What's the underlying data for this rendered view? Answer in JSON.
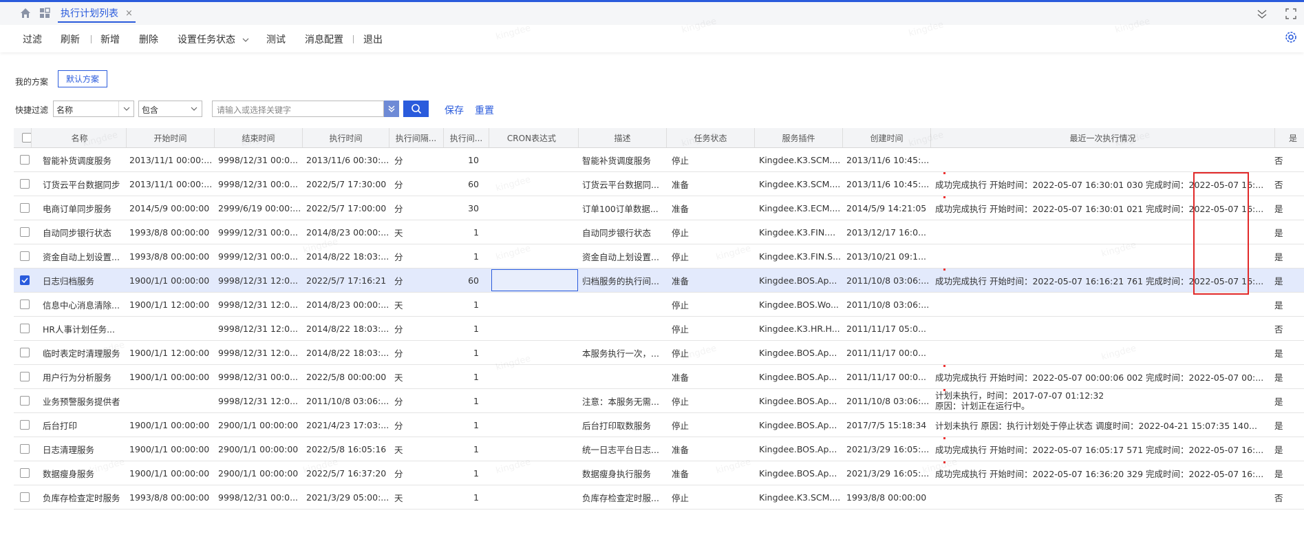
{
  "tabs": {
    "active_label": "执行计划列表",
    "close_glyph": "×"
  },
  "toolbar": {
    "filter": "过滤",
    "refresh": "刷新",
    "add": "新增",
    "delete": "删除",
    "set_status": "设置任务状态",
    "test": "测试",
    "msg_config": "消息配置",
    "exit": "退出"
  },
  "scheme": {
    "label": "我的方案",
    "default_btn": "默认方案"
  },
  "quick_filter": {
    "label": "快捷过滤",
    "field_value": "名称",
    "operator_value": "包含",
    "keyword_placeholder": "请输入或选择关键字",
    "save": "保存",
    "reset": "重置"
  },
  "table": {
    "headers": {
      "name": "名称",
      "start": "开始时间",
      "end": "结束时间",
      "exec_time": "执行时间",
      "interval_unit": "执行间隔...",
      "interval": "执行间...",
      "cron": "CRON表达式",
      "desc": "描述",
      "status": "任务状态",
      "plugin": "服务插件",
      "created": "创建时间",
      "last_exec": "最近一次执行情况",
      "enabled": "是"
    },
    "rows": [
      {
        "checked": false,
        "name": "智能补货调度服务",
        "start": "2013/11/1 00:00:...",
        "end": "9998/12/31 00:0...",
        "exec": "2013/11/6 00:30:...",
        "unit": "分",
        "interval": "10",
        "desc": "智能补货调度服务",
        "status": "停止",
        "plugin": "Kingdee.K3.SCM....",
        "created": "2013/11/6 10:45:...",
        "last1": "",
        "last2": "",
        "enabled": "否",
        "mark": false
      },
      {
        "checked": false,
        "name": "订货云平台数据同步",
        "start": "2013/11/1 00:00:...",
        "end": "9998/12/31 00:0...",
        "exec": "2022/5/7 17:30:00",
        "unit": "分",
        "interval": "60",
        "desc": "订货云平台数据同...",
        "status": "准备",
        "plugin": "Kingdee.K3.SCM....",
        "created": "2013/11/6 10:45:...",
        "last1": "成功完成执行  开始时间：2022-05-07 16:30:01 030  完成时间：2022-05-07 16:...",
        "last2": "",
        "enabled": "否",
        "mark": true
      },
      {
        "checked": false,
        "name": "电商订单同步服务",
        "start": "2014/5/9 00:00:00",
        "end": "2999/6/19 00:00:...",
        "exec": "2022/5/7 17:00:00",
        "unit": "分",
        "interval": "30",
        "desc": "订单100订单数据...",
        "status": "准备",
        "plugin": "Kingdee.K3.ECM....",
        "created": "2014/5/9 14:21:05",
        "last1": "成功完成执行  开始时间：2022-05-07 16:30:01 021  完成时间：2022-05-07 16:...",
        "last2": "",
        "enabled": "是",
        "mark": true
      },
      {
        "checked": false,
        "name": "自动同步银行状态",
        "start": "1993/8/8 00:00:00",
        "end": "9999/12/31 00:0...",
        "exec": "2014/8/23 00:00:...",
        "unit": "天",
        "interval": "1",
        "desc": "自动同步银行状态",
        "status": "停止",
        "plugin": "Kingdee.K3.FIN....",
        "created": "2013/12/17 16:0...",
        "last1": "",
        "last2": "",
        "enabled": "是",
        "mark": false
      },
      {
        "checked": false,
        "name": "资金自动上划设置...",
        "start": "1993/8/8 00:00:00",
        "end": "9999/12/31 00:0...",
        "exec": "2014/8/22 18:03:...",
        "unit": "分",
        "interval": "1",
        "desc": "资金自动上划设置...",
        "status": "停止",
        "plugin": "Kingdee.K3.FIN.S...",
        "created": "2013/10/21 09:1...",
        "last1": "",
        "last2": "",
        "enabled": "是",
        "mark": false
      },
      {
        "checked": true,
        "name": "日志归档服务",
        "start": "1900/1/1 00:00:00",
        "end": "9998/12/31 12:0...",
        "exec": "2022/5/7 17:16:21",
        "unit": "分",
        "interval": "60",
        "desc": "归档服务的执行间...",
        "status": "准备",
        "plugin": "Kingdee.BOS.Ap...",
        "created": "2011/10/8 03:06:...",
        "last1": "成功完成执行  开始时间：2022-05-07 16:16:21 761  完成时间：2022-05-07 16:...",
        "last2": "",
        "enabled": "是",
        "mark": true
      },
      {
        "checked": false,
        "name": "信息中心消息清除...",
        "start": "1900/1/1 12:00:00",
        "end": "9998/12/31 12:0...",
        "exec": "2014/8/23 00:00:...",
        "unit": "天",
        "interval": "1",
        "desc": "",
        "status": "停止",
        "plugin": "Kingdee.BOS.Wo...",
        "created": "2011/10/8 03:06:...",
        "last1": "",
        "last2": "",
        "enabled": "是",
        "mark": false
      },
      {
        "checked": false,
        "name": "HR人事计划任务...",
        "start": "",
        "end": "9998/12/31 12:0...",
        "exec": "2014/8/22 18:03:...",
        "unit": "分",
        "interval": "1",
        "desc": "",
        "status": "停止",
        "plugin": "Kingdee.K3.HR.H...",
        "created": "2011/11/17 05:0...",
        "last1": "",
        "last2": "",
        "enabled": "否",
        "mark": false
      },
      {
        "checked": false,
        "name": "临时表定时清理服务",
        "start": "1900/1/1 12:00:00",
        "end": "9998/12/31 12:0...",
        "exec": "2014/8/22 18:03:...",
        "unit": "分",
        "interval": "1",
        "desc": "本服务执行一次，...",
        "status": "停止",
        "plugin": "Kingdee.BOS.Ap...",
        "created": "2011/11/17 00:0...",
        "last1": "",
        "last2": "",
        "enabled": "是",
        "mark": false
      },
      {
        "checked": false,
        "name": "用户行为分析服务",
        "start": "1900/1/1 00:00:00",
        "end": "9998/12/31 00:0...",
        "exec": "2022/5/8 00:00:00",
        "unit": "天",
        "interval": "1",
        "desc": "",
        "status": "准备",
        "plugin": "Kingdee.BOS.Ap...",
        "created": "2011/11/17 00:0...",
        "last1": "成功完成执行  开始时间：2022-05-07 00:00:06 002  完成时间：2022-05-07 00:...",
        "last2": "",
        "enabled": "是",
        "mark": true
      },
      {
        "checked": false,
        "name": "业务预警服务提供者",
        "start": "",
        "end": "9998/12/31 12:0...",
        "exec": "2011/10/8 03:06:...",
        "unit": "分",
        "interval": "1",
        "desc": "注意：本服务无需...",
        "status": "停止",
        "plugin": "Kingdee.BOS.Ap...",
        "created": "2011/10/8 03:06:...",
        "last1": "计划未执行，时间：2017-07-07 01:12:32",
        "last2": "原因：计划正在运行中。",
        "enabled": "是",
        "mark": true
      },
      {
        "checked": false,
        "name": "后台打印",
        "start": "1900/1/1 00:00:00",
        "end": "2900/1/1 00:00:00",
        "exec": "2021/4/23 17:03:...",
        "unit": "分",
        "interval": "1",
        "desc": "后台打印取数服务",
        "status": "停止",
        "plugin": "Kingdee.BOS.Ap...",
        "created": "2017/7/5 15:18:34",
        "last1": "计划未执行  原因：执行计划处于停止状态  调度时间：2022-04-21 15:07:35 140...",
        "last2": "",
        "enabled": "是",
        "mark": false
      },
      {
        "checked": false,
        "name": "日志清理服务",
        "start": "1900/1/1 00:00:00",
        "end": "2900/1/1 00:00:00",
        "exec": "2022/5/8 16:05:16",
        "unit": "天",
        "interval": "1",
        "desc": "统一日志平台日志...",
        "status": "准备",
        "plugin": "Kingdee.BOS.Ap...",
        "created": "2021/3/29 16:05:...",
        "last1": "成功完成执行  开始时间：2022-05-07 16:05:17 571  完成时间：2022-05-07 16:...",
        "last2": "",
        "enabled": "是",
        "mark": true
      },
      {
        "checked": false,
        "name": "数据瘦身服务",
        "start": "1900/1/1 00:00:00",
        "end": "2900/1/1 00:00:00",
        "exec": "2022/5/7 16:37:20",
        "unit": "分",
        "interval": "1",
        "desc": "数据瘦身执行服务",
        "status": "准备",
        "plugin": "Kingdee.BOS.Ap...",
        "created": "2021/3/29 16:05:...",
        "last1": "成功完成执行  开始时间：2022-05-07 16:36:20 329  完成时间：2022-05-07 16:...",
        "last2": "",
        "enabled": "是",
        "mark": true
      },
      {
        "checked": false,
        "name": "负库存检查定时服务",
        "start": "1993/8/8 00:00:00",
        "end": "9998/12/31 00:0...",
        "exec": "2021/3/29 05:00:...",
        "unit": "天",
        "interval": "1",
        "desc": "负库存检查定时服...",
        "status": "停止",
        "plugin": "Kingdee.K3.SCM....",
        "created": "1993/8/8 00:00:00",
        "last1": "",
        "last2": "",
        "enabled": "否",
        "mark": false
      }
    ]
  },
  "watermark": "kingdee",
  "colors": {
    "accent": "#2a5bdc",
    "annotation": "#e12828",
    "selected_row": "#e3eafc"
  }
}
